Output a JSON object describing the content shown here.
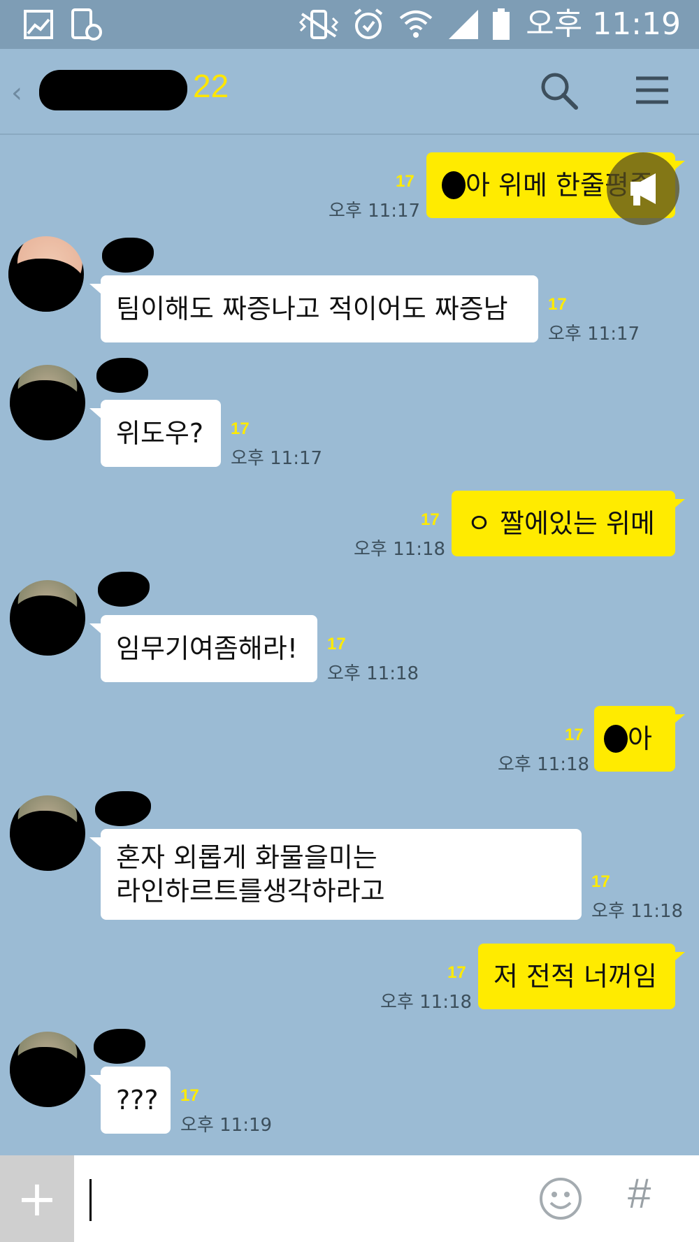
{
  "status_bar": {
    "clock": "오후 11:19",
    "icons": [
      "gallery-icon",
      "screenshot-icon",
      "vibrate-icon",
      "alarm-icon",
      "wifi-icon",
      "signal-icon",
      "battery-icon"
    ]
  },
  "header": {
    "member_count": "22",
    "icons": [
      "back-chevron-icon",
      "search-icon",
      "menu-icon"
    ]
  },
  "messages": [
    {
      "side": "me",
      "text_after_face": "아 위메 한줄평좀",
      "unread": "17",
      "time": "오후 11:17"
    },
    {
      "side": "other",
      "text": "팀이해도 짜증나고 적이어도 짜증남",
      "unread": "17",
      "time": "오후 11:17"
    },
    {
      "side": "other",
      "text": "위도우?",
      "unread": "17",
      "time": "오후 11:17"
    },
    {
      "side": "me",
      "text": "ㅇ 짤에있는 위메",
      "unread": "17",
      "time": "오후 11:18"
    },
    {
      "side": "other",
      "text": "임무기여좀해라!",
      "unread": "17",
      "time": "오후 11:18"
    },
    {
      "side": "me",
      "text_after_face": "아",
      "unread": "17",
      "time": "오후 11:18"
    },
    {
      "side": "other",
      "line1": "혼자 외롭게 화물을미는",
      "line2": "라인하르트를생각하라고",
      "unread": "17",
      "time": "오후 11:18"
    },
    {
      "side": "me",
      "text": "저 전적 너꺼임",
      "unread": "17",
      "time": "오후 11:18"
    },
    {
      "side": "other",
      "text": "???",
      "unread": "17",
      "time": "오후 11:19"
    }
  ],
  "input_bar": {
    "plus_label": "+",
    "hash_label": "#"
  },
  "colors": {
    "chat_background": "#9bbbd4",
    "my_bubble": "#ffeb00",
    "other_bubble": "#ffffff",
    "unread_count": "#ffeb00"
  }
}
